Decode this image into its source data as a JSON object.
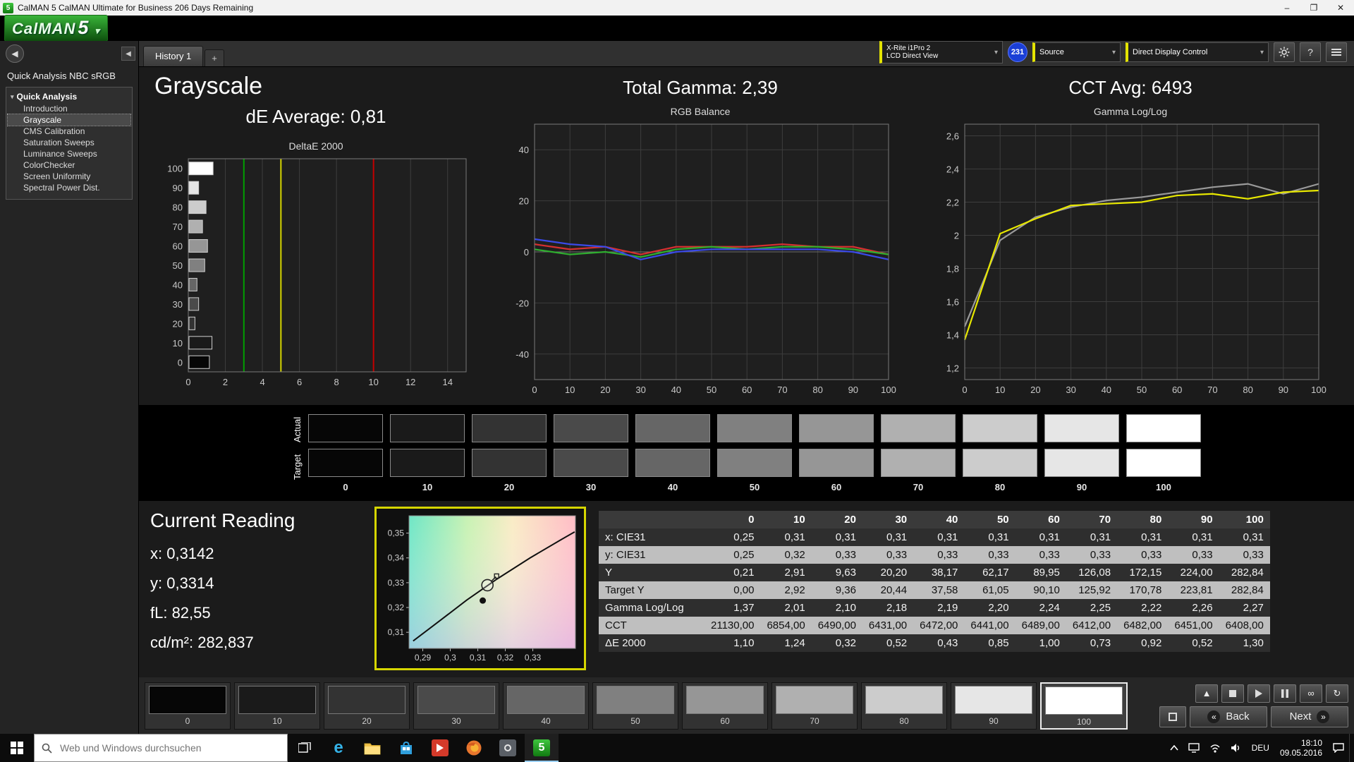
{
  "window": {
    "title": "CalMAN 5 CalMAN Ultimate for Business 206 Days Remaining"
  },
  "logo": {
    "text": "CalMAN",
    "number": "5"
  },
  "sidebar": {
    "workspace_label": "Quick Analysis NBC sRGB",
    "tree_root": "Quick Analysis",
    "items": [
      {
        "label": "Introduction",
        "selected": false
      },
      {
        "label": "Grayscale",
        "selected": true
      },
      {
        "label": "CMS Calibration",
        "selected": false
      },
      {
        "label": "Saturation Sweeps",
        "selected": false
      },
      {
        "label": "Luminance Sweeps",
        "selected": false
      },
      {
        "label": "ColorChecker",
        "selected": false
      },
      {
        "label": "Screen Uniformity",
        "selected": false
      },
      {
        "label": "Spectral Power Dist.",
        "selected": false
      }
    ]
  },
  "tabs": {
    "active": "History 1",
    "add": "+"
  },
  "toolbar": {
    "meter": {
      "line1": "X-Rite i1Pro 2",
      "line2": "LCD Direct View"
    },
    "badge": "231",
    "source": "Source",
    "display_control": "Direct Display Control"
  },
  "summary": {
    "grayscale_title": "Grayscale",
    "de_average": "dE Average: 0,81",
    "total_gamma": "Total Gamma: 2,39",
    "cct_avg": "CCT Avg: 6493"
  },
  "chart_data": [
    {
      "type": "bar",
      "title": "DeltaE 2000",
      "orientation": "horizontal",
      "categories": [
        "0",
        "10",
        "20",
        "30",
        "40",
        "50",
        "60",
        "70",
        "80",
        "90",
        "100"
      ],
      "values": [
        1.1,
        1.24,
        0.32,
        0.52,
        0.43,
        0.85,
        1.0,
        0.73,
        0.92,
        0.52,
        1.3
      ],
      "bar_colors": [
        "#060606",
        "#1a1a1a",
        "#333333",
        "#4a4a4a",
        "#666666",
        "#808080",
        "#969696",
        "#b0b0b0",
        "#cccccc",
        "#e6e6e6",
        "#ffffff"
      ],
      "xlim": [
        0,
        15
      ],
      "x_ticks": [
        0,
        2,
        4,
        6,
        8,
        10,
        12,
        14
      ],
      "reference_lines": [
        {
          "x": 3,
          "color": "#00a000",
          "meaning": "good"
        },
        {
          "x": 5,
          "color": "#d5d500",
          "meaning": "warning"
        },
        {
          "x": 10,
          "color": "#c40000",
          "meaning": "bad"
        }
      ]
    },
    {
      "type": "line",
      "title": "RGB Balance",
      "x": [
        0,
        10,
        20,
        30,
        40,
        50,
        60,
        70,
        80,
        90,
        100
      ],
      "xlim": [
        0,
        100
      ],
      "ylim": [
        -50,
        50
      ],
      "x_ticks": [
        0,
        10,
        20,
        30,
        40,
        50,
        60,
        70,
        80,
        90,
        100
      ],
      "y_ticks": [
        40,
        20,
        0,
        -20,
        -40
      ],
      "y_tick_labels": [
        "40",
        "20",
        "0",
        "-20",
        "-40"
      ],
      "series": [
        {
          "name": "Red",
          "color": "#d43030",
          "values": [
            3,
            1,
            2,
            -1,
            2,
            2,
            2,
            3,
            2,
            2,
            -1
          ]
        },
        {
          "name": "Green",
          "color": "#2fae2f",
          "values": [
            1,
            -1,
            0,
            -2,
            1,
            2,
            1,
            2,
            2,
            1,
            -1
          ]
        },
        {
          "name": "Blue",
          "color": "#3a4ae8",
          "values": [
            5,
            3,
            2,
            -3,
            0,
            1,
            1,
            1,
            1,
            0,
            -3
          ]
        }
      ]
    },
    {
      "type": "line",
      "title": "Gamma Log/Log",
      "x": [
        0,
        10,
        20,
        30,
        40,
        50,
        60,
        70,
        80,
        90,
        100
      ],
      "xlim": [
        0,
        100
      ],
      "ylim": [
        1.13,
        2.67
      ],
      "x_ticks": [
        0,
        10,
        20,
        30,
        40,
        50,
        60,
        70,
        80,
        90,
        100
      ],
      "y_ticks": [
        2.6,
        2.4,
        2.2,
        2.0,
        1.8,
        1.6,
        1.4,
        1.2
      ],
      "y_tick_labels": [
        "2,6",
        "2,4",
        "2,2",
        "2",
        "1,8",
        "1,6",
        "1,4",
        "1,2"
      ],
      "series": [
        {
          "name": "Reference",
          "color": "#9a9a9a",
          "values": [
            1.45,
            1.97,
            2.11,
            2.17,
            2.21,
            2.23,
            2.26,
            2.29,
            2.31,
            2.25,
            2.31
          ]
        },
        {
          "name": "Measured",
          "color": "#e8e800",
          "values": [
            1.37,
            2.01,
            2.1,
            2.18,
            2.19,
            2.2,
            2.24,
            2.25,
            2.22,
            2.26,
            2.27
          ]
        }
      ]
    }
  ],
  "swatches": {
    "row_labels": [
      "Actual",
      "Target"
    ],
    "levels": [
      "0",
      "10",
      "20",
      "30",
      "40",
      "50",
      "60",
      "70",
      "80",
      "90",
      "100"
    ],
    "colors": [
      "#060606",
      "#1a1a1a",
      "#333333",
      "#4a4a4a",
      "#666666",
      "#808080",
      "#969696",
      "#b0b0b0",
      "#cccccc",
      "#e6e6e6",
      "#ffffff"
    ]
  },
  "current_reading": {
    "title": "Current Reading",
    "lines": [
      "x: 0,3142",
      "y: 0,3314",
      "fL: 82,55",
      "cd/m²: 282,837"
    ]
  },
  "cie": {
    "xlim": [
      0.285,
      0.3455
    ],
    "ylim": [
      0.3035,
      0.357
    ],
    "x_tick_vals": [
      0.29,
      0.3,
      0.31,
      0.32,
      0.33
    ],
    "x_tick_labels": [
      "0,29",
      "0,3",
      "0,31",
      "0,32",
      "0,33"
    ],
    "y_tick_vals": [
      0.35,
      0.34,
      0.33,
      0.32,
      0.31
    ],
    "y_tick_labels": [
      "0,35",
      "0,34",
      "0,33",
      "0,32",
      "0,31"
    ],
    "locus": [
      [
        0.2865,
        0.3065
      ],
      [
        0.296,
        0.3145
      ],
      [
        0.306,
        0.323
      ],
      [
        0.317,
        0.3315
      ],
      [
        0.329,
        0.34
      ],
      [
        0.3405,
        0.3475
      ],
      [
        0.3452,
        0.3505
      ]
    ],
    "measured_marker": [
      0.3135,
      0.329
    ],
    "target_dot": [
      0.3118,
      0.3228
    ]
  },
  "table": {
    "columns": [
      "0",
      "10",
      "20",
      "30",
      "40",
      "50",
      "60",
      "70",
      "80",
      "90",
      "100"
    ],
    "rows": [
      {
        "label": "x: CIE31",
        "values": [
          "0,25",
          "0,31",
          "0,31",
          "0,31",
          "0,31",
          "0,31",
          "0,31",
          "0,31",
          "0,31",
          "0,31",
          "0,31"
        ]
      },
      {
        "label": "y: CIE31",
        "values": [
          "0,25",
          "0,32",
          "0,33",
          "0,33",
          "0,33",
          "0,33",
          "0,33",
          "0,33",
          "0,33",
          "0,33",
          "0,33"
        ]
      },
      {
        "label": "Y",
        "values": [
          "0,21",
          "2,91",
          "9,63",
          "20,20",
          "38,17",
          "62,17",
          "89,95",
          "126,08",
          "172,15",
          "224,00",
          "282,84"
        ]
      },
      {
        "label": "Target Y",
        "values": [
          "0,00",
          "2,92",
          "9,36",
          "20,44",
          "37,58",
          "61,05",
          "90,10",
          "125,92",
          "170,78",
          "223,81",
          "282,84"
        ]
      },
      {
        "label": "Gamma Log/Log",
        "values": [
          "1,37",
          "2,01",
          "2,10",
          "2,18",
          "2,19",
          "2,20",
          "2,24",
          "2,25",
          "2,22",
          "2,26",
          "2,27"
        ]
      },
      {
        "label": "CCT",
        "values": [
          "21130,00",
          "6854,00",
          "6490,00",
          "6431,00",
          "6472,00",
          "6441,00",
          "6489,00",
          "6412,00",
          "6482,00",
          "6451,00",
          "6408,00"
        ]
      },
      {
        "label": "ΔE 2000",
        "values": [
          "1,10",
          "1,24",
          "0,32",
          "0,52",
          "0,43",
          "0,85",
          "1,00",
          "0,73",
          "0,92",
          "0,52",
          "1,30"
        ]
      }
    ]
  },
  "patch_bar": {
    "selected_index": 10
  },
  "transport": {
    "back": "Back",
    "next": "Next",
    "infinity": "∞",
    "loop": "↻",
    "scroll_up": "▲"
  },
  "taskbar": {
    "search_placeholder": "Web und Windows durchsuchen",
    "lang": "DEU",
    "time": "18:10",
    "date": "09.05.2016"
  }
}
